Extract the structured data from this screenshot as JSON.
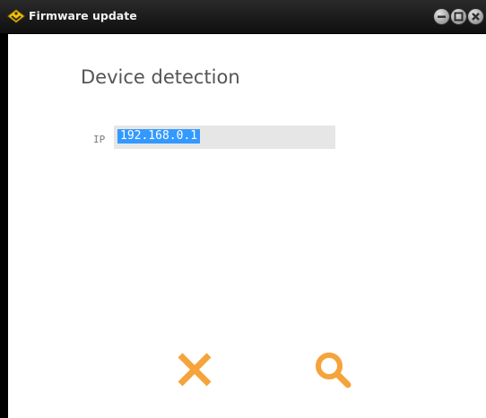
{
  "window": {
    "title": "Firmware update",
    "app_icon": "yellow-diamond-icon",
    "controls": [
      "minimize-icon",
      "maximize-icon",
      "close-icon"
    ]
  },
  "main": {
    "heading": "Device detection",
    "ip_label": "IP",
    "ip_value": "192.168.0.1",
    "ip_selected": true
  },
  "actions": {
    "cancel_icon": "x-cancel-icon",
    "search_icon": "magnifier-search-icon"
  },
  "colors": {
    "titlebar": "#1a1a1a",
    "accent": "#f5a33b",
    "selection": "#3399ff",
    "field_background": "#e6e6e6",
    "heading": "#555555"
  }
}
